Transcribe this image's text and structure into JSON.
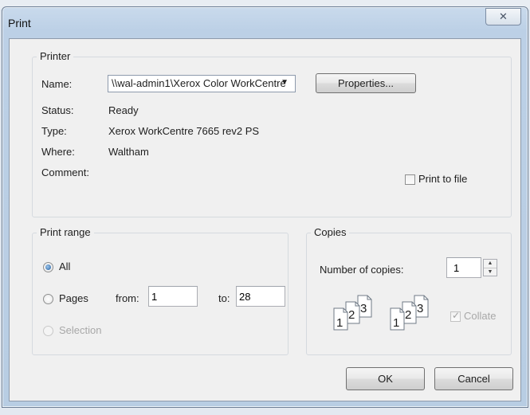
{
  "dialog": {
    "title": "Print",
    "close_glyph": "✕"
  },
  "printer": {
    "group_title": "Printer",
    "name_label": "Name:",
    "name_value": "\\\\wal-admin1\\Xerox Color WorkCentre",
    "properties_label": "Properties...",
    "status_label": "Status:",
    "status_value": "Ready",
    "type_label": "Type:",
    "type_value": "Xerox WorkCentre 7665 rev2 PS",
    "where_label": "Where:",
    "where_value": "Waltham",
    "comment_label": "Comment:",
    "comment_value": "",
    "print_to_file_label": "Print to file",
    "print_to_file_checked": false
  },
  "range": {
    "group_title": "Print range",
    "all_label": "All",
    "all_selected": true,
    "pages_label": "Pages",
    "from_label": "from:",
    "from_value": "1",
    "to_label": "to:",
    "to_value": "28",
    "selection_label": "Selection"
  },
  "copies": {
    "group_title": "Copies",
    "number_label": "Number of copies:",
    "number_value": "1",
    "collate_label": "Collate",
    "collate_checked": true,
    "page_digits": [
      "1",
      "2",
      "3"
    ]
  },
  "buttons": {
    "ok": "OK",
    "cancel": "Cancel"
  },
  "icons": {
    "close": "close-icon",
    "dropdown": "chevron-down-icon",
    "spin_up": "spin-up-icon",
    "spin_down": "spin-down-icon"
  }
}
